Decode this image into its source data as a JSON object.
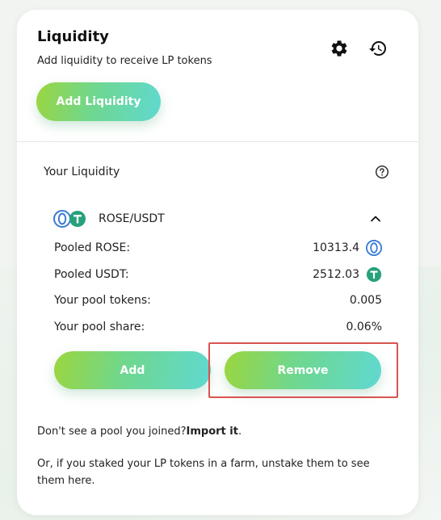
{
  "header": {
    "title": "Liquidity",
    "subtitle": "Add liquidity to receive LP tokens",
    "add_liquidity_label": "Add Liquidity",
    "settings_icon": "gear-icon",
    "history_icon": "history-icon"
  },
  "your_liquidity": {
    "label": "Your Liquidity",
    "help_icon": "help-circle-icon"
  },
  "pool": {
    "pair": "ROSE/USDT",
    "rows": [
      {
        "label": "Pooled ROSE:",
        "value": "10313.4"
      },
      {
        "label": "Pooled USDT:",
        "value": "2512.03"
      },
      {
        "label": "Your pool tokens:",
        "value": "0.005"
      },
      {
        "label": "Your pool share:",
        "value": "0.06%"
      }
    ],
    "add_label": "Add",
    "remove_label": "Remove"
  },
  "footer": {
    "note1_prefix": "Don't see a pool you joined?",
    "note1_link": "Import it",
    "note1_suffix": ".",
    "note2": "Or, if you staked your LP tokens in a farm, unstake them to see them here."
  },
  "colors": {
    "gradient_start": "#9bd63f",
    "gradient_end": "#60d8d0",
    "rose": "#3a7bd5",
    "usdt": "#26a17b",
    "highlight": "#d9534f"
  }
}
